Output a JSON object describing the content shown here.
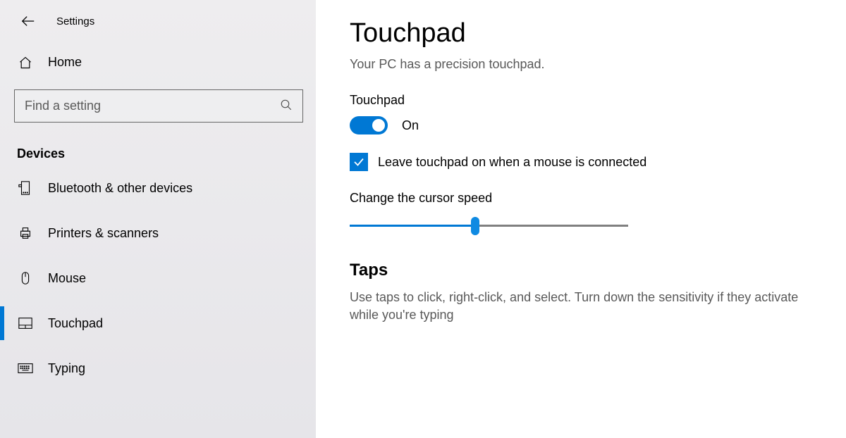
{
  "header": {
    "settings_label": "Settings"
  },
  "sidebar": {
    "home_label": "Home",
    "search_placeholder": "Find a setting",
    "section_title": "Devices",
    "items": [
      {
        "label": "Bluetooth & other devices",
        "active": false
      },
      {
        "label": "Printers & scanners",
        "active": false
      },
      {
        "label": "Mouse",
        "active": false
      },
      {
        "label": "Touchpad",
        "active": true
      },
      {
        "label": "Typing",
        "active": false
      }
    ]
  },
  "main": {
    "page_title": "Touchpad",
    "subtitle": "Your PC has a precision touchpad.",
    "touchpad_label": "Touchpad",
    "toggle_state": "On",
    "checkbox_label": "Leave touchpad on when a mouse is connected",
    "cursor_speed_label": "Change the cursor speed",
    "taps_heading": "Taps",
    "taps_desc": "Use taps to click, right-click, and select. Turn down the sensitivity if they activate while you're typing"
  }
}
